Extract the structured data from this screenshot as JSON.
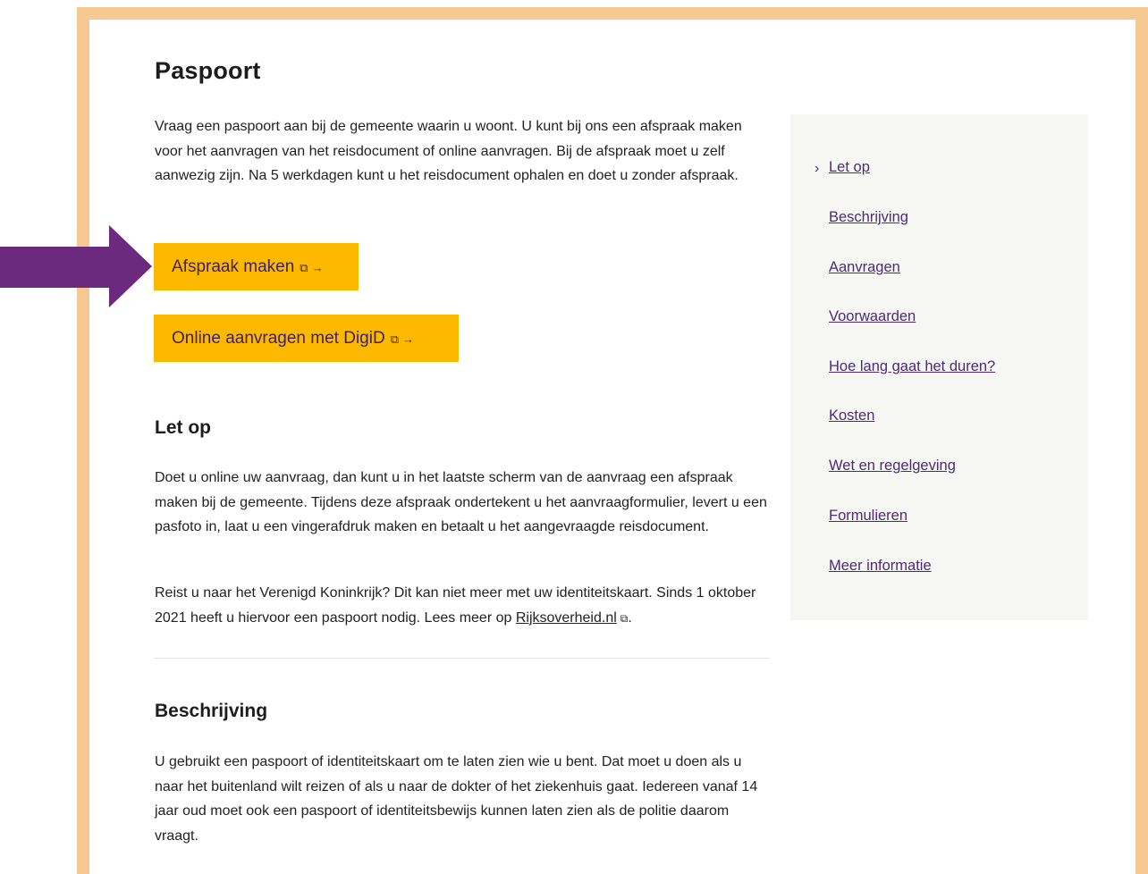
{
  "page": {
    "title": "Paspoort",
    "intro": "Vraag een paspoort aan bij de gemeente waarin u woont. U kunt bij ons een afspraak maken voor het aanvragen van het reisdocument of online aanvragen. Bij de afspraak moet u zelf aanwezig zijn. Na 5 werkdagen kunt u het reisdocument ophalen en doet u zonder afspraak."
  },
  "buttons": {
    "appointment": {
      "label": "Afspraak maken",
      "ext_icon": "external-link-icon",
      "arrow_icon": "arrow-right-icon"
    },
    "online": {
      "label": "Online aanvragen met DigiD",
      "ext_icon": "external-link-icon",
      "arrow_icon": "arrow-right-icon"
    }
  },
  "sections": {
    "letop": {
      "heading": "Let op",
      "p1": "Doet u online uw aanvraag, dan kunt u in het laatste scherm van de aanvraag een afspraak maken bij de gemeente. Tijdens deze afspraak ondertekent u het aanvraagformulier, levert u een pasfoto in, laat u een vingerafdruk maken en betaalt u het aangevraagde reisdocument.",
      "p2_before": "Reist u naar het Verenigd Koninkrijk? Dit kan niet meer met uw identiteitskaart. Sinds 1 oktober 2021 heeft u hiervoor een paspoort nodig. Lees meer op ",
      "p2_link": "Rijksoverheid.nl",
      "p2_after": "."
    },
    "beschrijving": {
      "heading": "Beschrijving",
      "p1": "U gebruikt een paspoort of identiteitskaart om te laten zien wie u bent. Dat moet u doen als u naar het buitenland wilt reizen of als u naar de dokter of het ziekenhuis gaat. Iedereen vanaf 14 jaar oud moet ook een paspoort of identiteitsbewijs kunnen laten zien als de politie daarom vraagt."
    }
  },
  "toc": {
    "active_icon": "chevron-right-icon",
    "items": [
      {
        "label": "Let op"
      },
      {
        "label": "Beschrijving"
      },
      {
        "label": "Aanvragen"
      },
      {
        "label": "Voorwaarden"
      },
      {
        "label": "Hoe lang gaat het duren?"
      },
      {
        "label": "Kosten"
      },
      {
        "label": "Wet en regelgeving"
      },
      {
        "label": "Formulieren"
      },
      {
        "label": "Meer informatie"
      }
    ]
  },
  "annotation": {
    "icon": "arrow-right-icon",
    "color": "#6b2a7d"
  },
  "colors": {
    "frame": "#f6c992",
    "button_bg": "#fdb900",
    "button_text": "#3f2262",
    "link": "#4b2a7a",
    "sidebar_bg": "#f6f7f2"
  }
}
